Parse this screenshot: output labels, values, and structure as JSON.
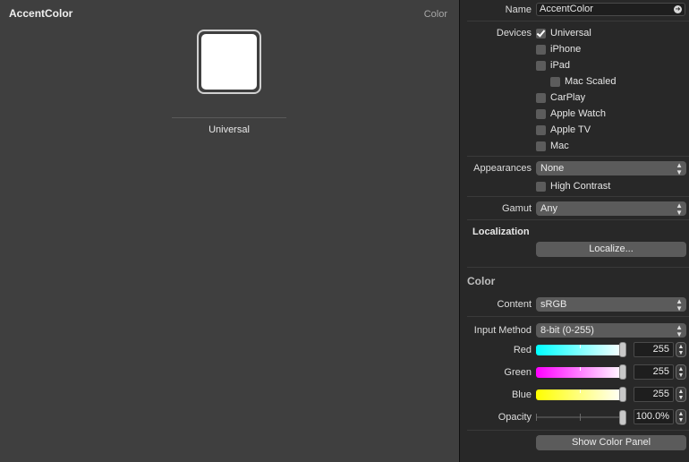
{
  "canvas": {
    "title": "AccentColor",
    "type_label": "Color",
    "swatch_label": "Universal",
    "swatch_color": "#ffffff"
  },
  "inspector": {
    "name": {
      "label": "Name",
      "value": "AccentColor"
    },
    "devices": {
      "label": "Devices",
      "items": [
        {
          "label": "Universal",
          "checked": true
        },
        {
          "label": "iPhone",
          "checked": false
        },
        {
          "label": "iPad",
          "checked": false
        },
        {
          "label": "Mac Scaled",
          "checked": false
        },
        {
          "label": "CarPlay",
          "checked": false
        },
        {
          "label": "Apple Watch",
          "checked": false
        },
        {
          "label": "Apple TV",
          "checked": false
        },
        {
          "label": "Mac",
          "checked": false
        }
      ]
    },
    "appearances": {
      "label": "Appearances",
      "value": "None",
      "high_contrast_label": "High Contrast"
    },
    "gamut": {
      "label": "Gamut",
      "value": "Any"
    },
    "localization": {
      "label": "Localization",
      "button_label": "Localize..."
    },
    "color": {
      "section_title": "Color",
      "content": {
        "label": "Content",
        "value": "sRGB"
      },
      "input_method": {
        "label": "Input Method",
        "value": "8-bit (0-255)"
      },
      "red": {
        "label": "Red",
        "value": "255",
        "fraction": 1.0
      },
      "green": {
        "label": "Green",
        "value": "255",
        "fraction": 1.0
      },
      "blue": {
        "label": "Blue",
        "value": "255",
        "fraction": 1.0
      },
      "opacity": {
        "label": "Opacity",
        "value": "100.0%",
        "fraction": 1.0
      },
      "show_panel_label": "Show Color Panel"
    }
  },
  "colors": {
    "red_gradient": [
      "#00ffff",
      "#ffffff"
    ],
    "green_gradient": [
      "#ff00ff",
      "#ffffff"
    ],
    "blue_gradient": [
      "#ffff00",
      "#ffffff"
    ]
  }
}
